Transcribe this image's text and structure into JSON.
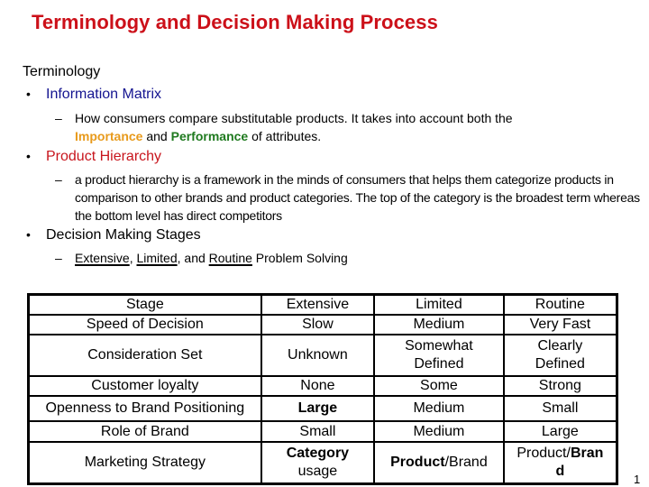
{
  "title": "Terminology and Decision Making Process",
  "heading": "Terminology",
  "bullets": [
    {
      "term": "Information Matrix",
      "color": "#151590",
      "sub_lines": {
        "line1": "How consumers compare substitutable products.  It takes into account both the",
        "importance": "Importance",
        "and": "and",
        "performance": "Performance",
        "rest": "of attributes."
      }
    },
    {
      "term": "Product Hierarchy",
      "color": "#c8151d",
      "sub_text": "a product hierarchy is a framework in the minds of consumers that helps them categorize products in comparison to other brands and product categories.  The top of the category is the broadest term whereas the bottom level has direct competitors"
    },
    {
      "term": "Decision Making Stages",
      "color": "#000000",
      "sub_parts": {
        "extensive": "Extensive",
        "comma1": ", ",
        "limited": "Limited",
        "and": ", and ",
        "routine": "Routine",
        "rest": " Problem Solving"
      }
    }
  ],
  "bullet_symbol": "•",
  "dash_symbol": "–",
  "table": {
    "headers": [
      "Stage",
      "Extensive",
      "Limited",
      "Routine"
    ],
    "rows": [
      {
        "label": "Speed of Decision",
        "extensive": "Slow",
        "limited": "Medium",
        "routine": "Very Fast"
      },
      {
        "label": "Consideration Set",
        "extensive": "Unknown",
        "limited_l1": "Somewhat",
        "limited_l2": "Defined",
        "routine_l1": "Clearly",
        "routine_l2": "Defined"
      },
      {
        "label": "Customer loyalty",
        "extensive": "None",
        "limited": "Some",
        "routine": "Strong"
      },
      {
        "label": "Openness to Brand Positioning",
        "extensive": "Large",
        "limited": "Medium",
        "routine": "Small"
      },
      {
        "label": "Role of Brand",
        "extensive": "Small",
        "limited": "Medium",
        "routine": "Large"
      },
      {
        "label": "Marketing Strategy",
        "extensive_l1": "Category",
        "extensive_l2": "usage",
        "limited_a": "Product",
        "limited_b": "/Brand",
        "routine_a": "Product/",
        "routine_b": "Bran",
        "routine_c": "d"
      }
    ]
  },
  "colors": {
    "title": "#cc1019",
    "importance": "#e89a1b",
    "performance": "#1f7a1f"
  },
  "page_number": "1"
}
